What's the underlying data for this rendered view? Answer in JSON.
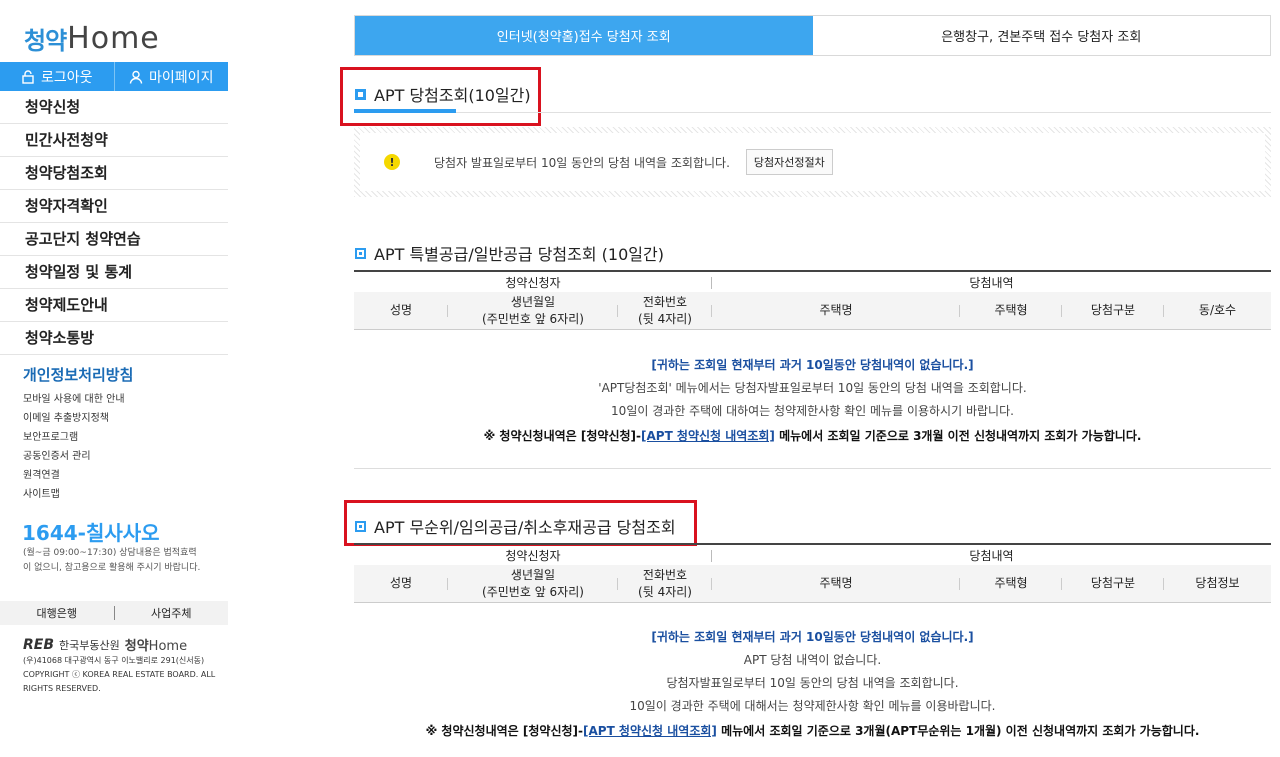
{
  "logo": {
    "ko": "청약",
    "en": "Home"
  },
  "auth": {
    "logout": "로그아웃",
    "mypage": "마이페이지"
  },
  "menu": [
    "청약신청",
    "민간사전청약",
    "청약당첨조회",
    "청약자격확인",
    "공고단지 청약연습",
    "청약일정 및 통계",
    "청약제도안내",
    "청약소통방"
  ],
  "privacy": "개인정보처리방침",
  "sublinks": [
    "모바일 사용에 대한 안내",
    "이메일 추출방지정책",
    "보안프로그램",
    "공동인증서 관리",
    "원격연결",
    "사이트맵"
  ],
  "phone": {
    "number": "1644-칠사사오",
    "note": "(월~금 09:00~17:30) 상담내용은 법적효력이 없으니, 참고용으로 활용해 주시기 바랍니다."
  },
  "footer_links": [
    "대행은행",
    "사업주체"
  ],
  "org": {
    "mark": "REB",
    "name": "한국부동산원",
    "home_ko": "청약",
    "home_en": "Home",
    "address": "(우)41068 대구광역시 동구 이노밸리로 291(신서동)",
    "copyright": "COPYRIGHT ⓒ KOREA REAL ESTATE BOARD. ALL RIGHTS RESERVED."
  },
  "tabs": {
    "active": "인터넷(청약홈)접수 당첨자 조회",
    "inactive": "은행창구, 견본주택 접수 당첨자 조회"
  },
  "section1": {
    "title": "APT 당첨조회(10일간)",
    "notice": "당첨자 발표일로부터 10일 동안의 당첨 내역을 조회합니다.",
    "button": "당첨자선정절차"
  },
  "section2": {
    "title": "APT 특별공급/일반공급 당첨조회 (10일간)",
    "group1": "청약신청자",
    "group2": "당첨내역",
    "cols": [
      "성명",
      "생년월일\n(주민번호 앞 6자리)",
      "전화번호\n(뒷 4자리)",
      "주택명",
      "주택형",
      "당첨구분",
      "동/호수"
    ],
    "msg1": "[귀하는 조회일 현재부터 과거 10일동안 당첨내역이 없습니다.]",
    "msg2": "'APT당첨조회' 메뉴에서는 당첨자발표일로부터 10일 동안의 당첨 내역을 조회합니다.",
    "msg3": "10일이 경과한 주택에 대하여는 청약제한사항 확인 메뉴를 이용하시기 바랍니다.",
    "msg4_pre": "※ 청약신청내역은 [청약신청]-",
    "msg4_link": "[APT 청약신청 내역조회]",
    "msg4_post": " 메뉴에서 조회일 기준으로 3개월 이전 신청내역까지 조회가 가능합니다."
  },
  "section3": {
    "title": "APT 무순위/임의공급/취소후재공급 당첨조회",
    "group1": "청약신청자",
    "group2": "당첨내역",
    "cols": [
      "성명",
      "생년월일\n(주민번호 앞 6자리)",
      "전화번호\n(뒷 4자리)",
      "주택명",
      "주택형",
      "당첨구분",
      "당첨정보"
    ],
    "msg1": "[귀하는 조회일 현재부터 과거 10일동안 당첨내역이 없습니다.]",
    "msg2": "APT 당첨 내역이 없습니다.",
    "msg3": "당첨자발표일로부터 10일 동안의 당첨 내역을 조회합니다.",
    "msg4": "10일이 경과한 주택에 대해서는 청약제한사항 확인 메뉴를 이용바랍니다.",
    "msg5_pre": "※ 청약신청내역은 [청약신청]-",
    "msg5_link": "[APT 청약신청 내역조회]",
    "msg5_post": " 메뉴에서 조회일 기준으로 3개월(APT무순위는 1개월) 이전 신청내역까지 조회가 가능합니다."
  },
  "colors": {
    "accent": "#2c9cf0",
    "highlight": "#d9121f",
    "link": "#1a4fa0"
  }
}
